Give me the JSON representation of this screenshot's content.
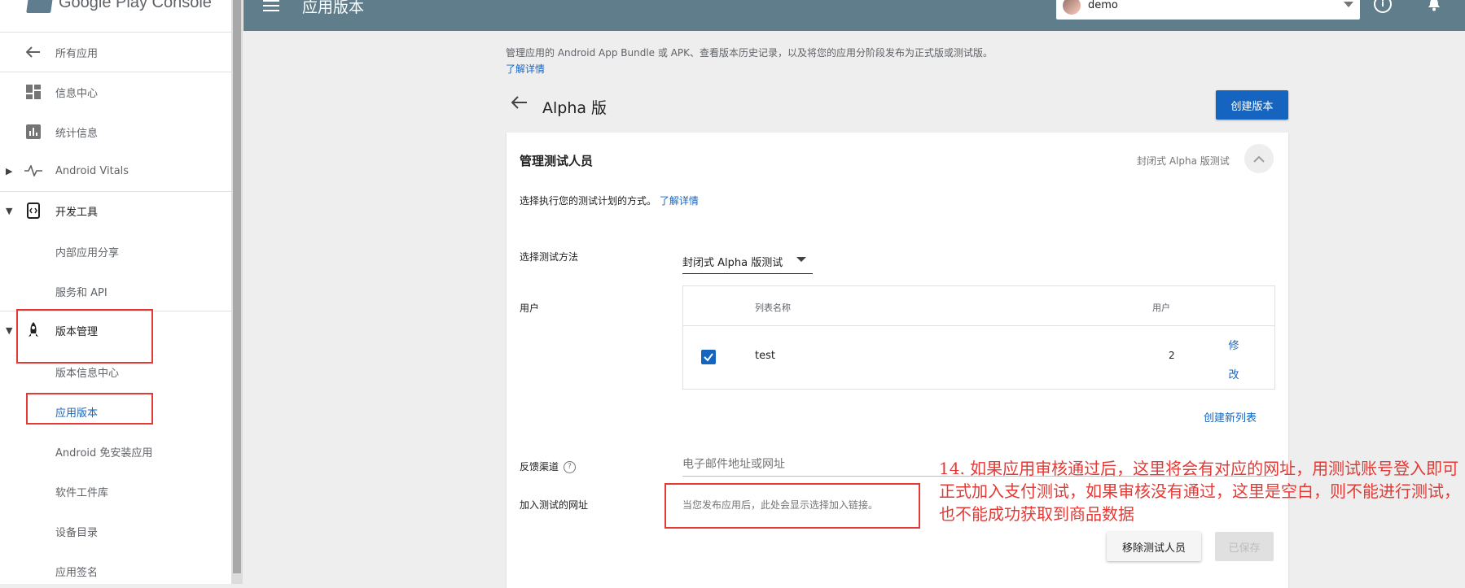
{
  "app": {
    "logo_text": "Google Play Console"
  },
  "topbar": {
    "title": "应用版本",
    "account_name": "demo"
  },
  "sidebar": {
    "back_label": "所有应用",
    "items": [
      {
        "label": "信息中心"
      },
      {
        "label": "统计信息"
      },
      {
        "label": "Android Vitals"
      },
      {
        "label": "开发工具"
      },
      {
        "label": "内部应用分享"
      },
      {
        "label": "服务和 API"
      },
      {
        "label": "版本管理"
      },
      {
        "label": "版本信息中心"
      },
      {
        "label": "应用版本"
      },
      {
        "label": "Android 免安装应用"
      },
      {
        "label": "软件工件库"
      },
      {
        "label": "设备目录"
      },
      {
        "label": "应用签名"
      }
    ]
  },
  "main": {
    "description": "管理应用的 Android App Bundle 或 APK、查看版本历史记录，以及将您的应用分阶段发布为正式版或测试版。",
    "learn_more": "了解详情",
    "track_title": "Alpha 版",
    "create_release": "创建版本"
  },
  "card": {
    "title": "管理测试人员",
    "status": "封闭式 Alpha 版测试",
    "description": "选择执行您的测试计划的方式。",
    "learn_more": "了解详情",
    "method_label": "选择测试方法",
    "method_value": "封闭式 Alpha 版测试",
    "users_label": "用户",
    "table": {
      "headers": [
        "列表名称",
        "用户"
      ],
      "rows": [
        {
          "name": "test",
          "users": "2",
          "checked": true,
          "action": "修改"
        }
      ]
    },
    "create_list": "创建新列表",
    "feedback_label": "反馈渠道",
    "feedback_placeholder": "电子邮件地址或网址",
    "join_url_label": "加入测试的网址",
    "join_url_text": "当您发布应用后，此处会显示选择加入链接。",
    "remove_testers": "移除测试人员",
    "saved": "已保存"
  },
  "annotation": "14. 如果应用审核通过后，这里将会有对应的网址，用测试账号登入即可正式加入支付测试，如果审核没有通过，这里是空白，则不能进行测试，也不能成功获取到商品数据",
  "colors": {
    "accent": "#1565c0",
    "topbar": "#607d8b",
    "annotation": "#e53935"
  },
  "icons": [
    "arrow-left-icon",
    "dashboard-icon",
    "bar-chart-icon",
    "vitals-icon",
    "dev-tools-icon",
    "rocket-icon",
    "menu-icon",
    "info-icon",
    "bell-icon",
    "help-icon",
    "chevron-up-icon",
    "checkbox-icon"
  ]
}
